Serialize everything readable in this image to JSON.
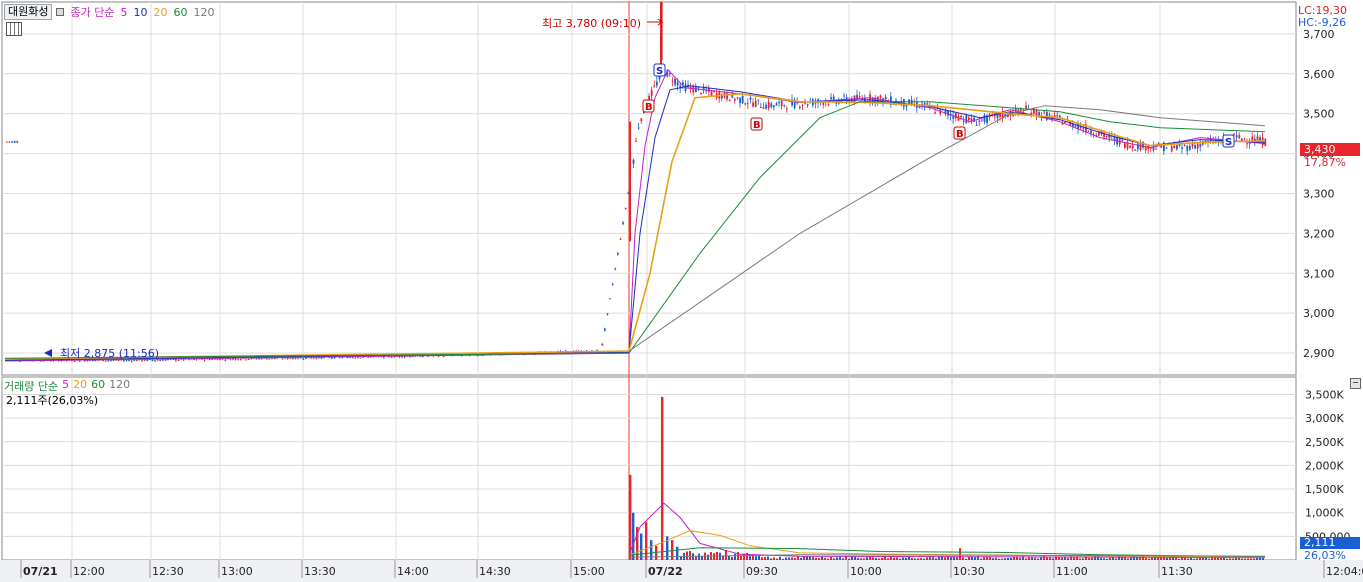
{
  "legend": {
    "stock_name": "대원화성",
    "price_prefix": "종가 단순",
    "ma_periods": [
      "5",
      "10",
      "20",
      "60",
      "120"
    ]
  },
  "volume_legend": {
    "title": "거래량 단순",
    "ma_periods": [
      "5",
      "20",
      "60",
      "120"
    ],
    "current": "2,111주(26,03%)"
  },
  "right_panel": {
    "lc": "LC:19,30",
    "hc": "HC:-9,26",
    "price_box": "3,430",
    "price_pct": "17,87%",
    "volume_box": "2,111",
    "volume_pct": "26,03%"
  },
  "annotations": {
    "high": "최고 3,780 (09:10)",
    "low": "최저 2,875 (11:56)",
    "markers": [
      {
        "label": "S",
        "time": "09:10"
      },
      {
        "label": "B",
        "time": "09:06"
      },
      {
        "label": "B",
        "time": "09:45"
      },
      {
        "label": "B",
        "time": "10:38"
      },
      {
        "label": "S",
        "time": "11:50"
      }
    ]
  },
  "colors": {
    "up": "#e8242c",
    "down": "#1a5fd1",
    "ma5": "#c024c0",
    "ma10": "#1a2dbf",
    "ma20": "#e6a117",
    "ma60": "#1a8c3a",
    "ma120": "#7a7a7a",
    "grid": "#dcdcdc"
  },
  "chart_data": [
    {
      "type": "candlestick",
      "title": "",
      "yticks": [
        "3,700",
        "3,600",
        "3,500",
        "3,400",
        "3,300",
        "3,200",
        "3,100",
        "3,000",
        "2,900"
      ],
      "ylim": [
        2845,
        3780
      ],
      "xticks": [
        "07/21",
        "12:00",
        "12:30",
        "13:00",
        "13:30",
        "14:00",
        "14:30",
        "15:00",
        "07/22",
        "09:30",
        "10:00",
        "10:30",
        "11:00",
        "11:30",
        "12:04:00"
      ],
      "series": [
        {
          "name": "종가",
          "x": [
            "07/21 11:50",
            "07/21 12:30",
            "07/21 13:30",
            "07/21 14:30",
            "07/21 15:20",
            "07/22 09:00",
            "07/22 09:03",
            "07/22 09:06",
            "07/22 09:10",
            "07/22 09:15",
            "07/22 09:25",
            "07/22 09:40",
            "07/22 09:55",
            "07/22 10:10",
            "07/22 10:25",
            "07/22 10:40",
            "07/22 10:55",
            "07/22 11:10",
            "07/22 11:25",
            "07/22 11:40",
            "07/22 11:55",
            "07/22 12:04"
          ],
          "values": [
            2883,
            2882,
            2888,
            2895,
            2905,
            3310,
            3480,
            3540,
            3610,
            3570,
            3550,
            3520,
            3530,
            3540,
            3520,
            3480,
            3510,
            3470,
            3420,
            3415,
            3440,
            3430
          ]
        }
      ]
    },
    {
      "type": "bar",
      "title": "",
      "yticks": [
        "3,500K",
        "3,000K",
        "2,500K",
        "2,000K",
        "1,500K",
        "1,000K",
        "500,000"
      ],
      "ylim": [
        0,
        3700
      ],
      "series": [
        {
          "name": "거래량",
          "x": [
            "07/22 09:00",
            "07/22 09:01",
            "07/22 09:05",
            "07/22 09:10",
            "07/22 09:15",
            "07/22 09:30",
            "07/22 10:40"
          ],
          "values": [
            1800,
            1000,
            700,
            3450,
            500,
            150,
            250
          ]
        }
      ]
    }
  ]
}
